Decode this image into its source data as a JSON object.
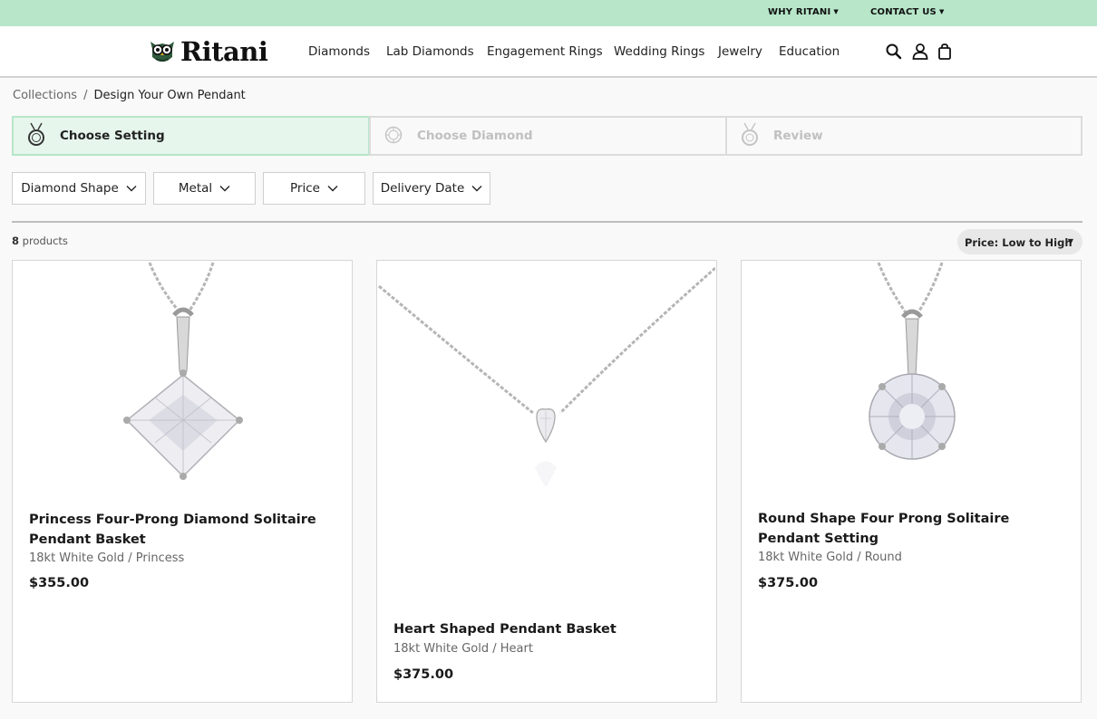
{
  "topbar": {
    "why_label": "WHY RITANI",
    "contact_label": "CONTACT US"
  },
  "logo": {
    "text": "Ritani"
  },
  "nav": [
    "Diamonds",
    "Lab Diamonds",
    "Engagement Rings",
    "Wedding Rings",
    "Jewelry",
    "Education"
  ],
  "breadcrumb": {
    "parent": "Collections",
    "separator": "/",
    "current": "Design Your Own Pendant"
  },
  "steps": [
    {
      "label": "Choose Setting",
      "active": true
    },
    {
      "label": "Choose Diamond",
      "active": false
    },
    {
      "label": "Review",
      "active": false
    }
  ],
  "filters": [
    "Diamond Shape",
    "Metal",
    "Price",
    "Delivery Date"
  ],
  "results": {
    "count": "8",
    "count_suffix": "products"
  },
  "sort": {
    "selected": "Price: Low to High"
  },
  "products": [
    {
      "title": "Princess Four-Prong Diamond Solitaire Pendant Basket",
      "subtitle": "18kt White Gold / Princess",
      "price": "$355.00",
      "shape": "princess"
    },
    {
      "title": "Heart Shaped Pendant Basket",
      "subtitle": "18kt White Gold / Heart",
      "price": "$375.00",
      "shape": "heart"
    },
    {
      "title": "Round Shape Four Prong Solitaire Pendant Setting",
      "subtitle": "18kt White Gold / Round",
      "price": "$375.00",
      "shape": "round"
    }
  ],
  "colors": {
    "accent": "#b7e6c9",
    "active_step_bg": "#e6f6ec"
  },
  "icons": [
    "search-icon",
    "account-icon",
    "bag-icon",
    "chevron-down-icon"
  ]
}
